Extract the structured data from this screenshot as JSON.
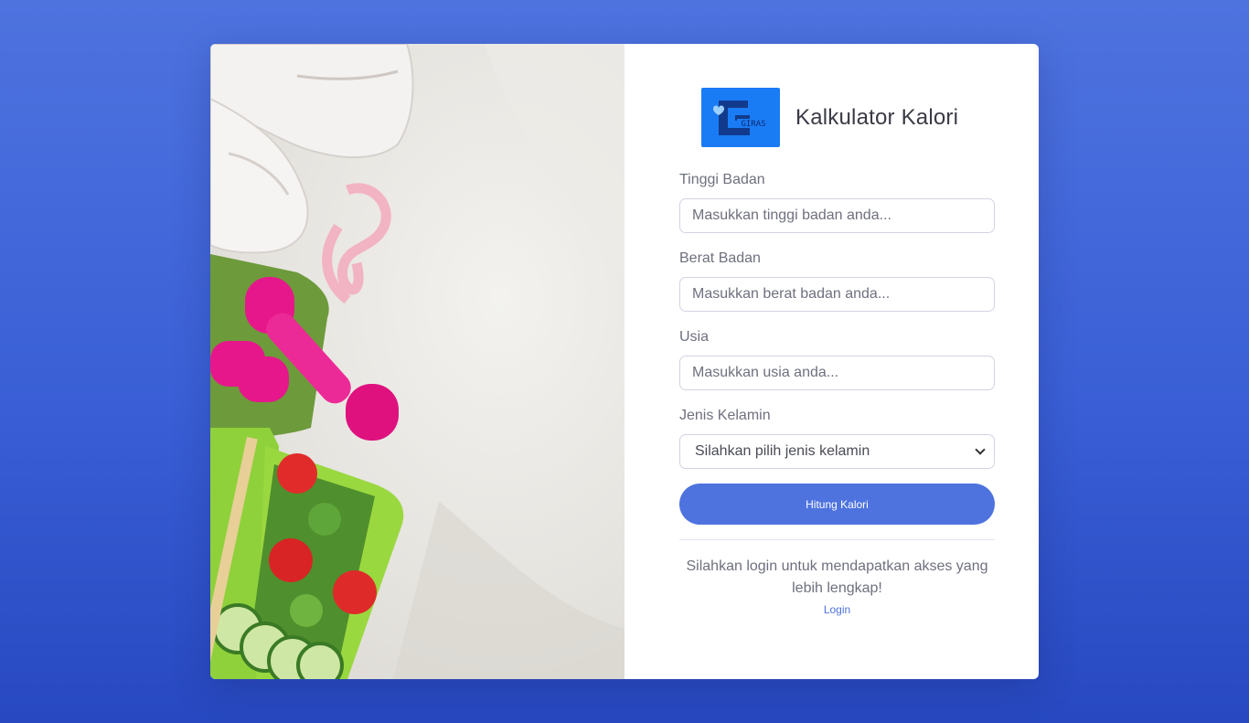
{
  "brand": {
    "title": "Kalkulator Kalori",
    "logo_text": "GIRAS"
  },
  "form": {
    "height_label": "Tinggi Badan",
    "height_placeholder": "Masukkan tinggi badan anda...",
    "weight_label": "Berat Badan",
    "weight_placeholder": "Masukkan berat badan anda...",
    "age_label": "Usia",
    "age_placeholder": "Masukkan usia anda...",
    "gender_label": "Jenis Kelamin",
    "gender_selected": "Silahkan pilih jenis kelamin",
    "submit_label": "Hitung Kalori"
  },
  "footer": {
    "note": "Silahkan login untuk mendapatkan akses yang lebih lengkap!",
    "login_label": "Login"
  },
  "colors": {
    "accent": "#4e73df",
    "logo_bg": "#1a7cf5",
    "page_bg_top": "#4e73df",
    "page_bg_bottom": "#2748c0"
  }
}
